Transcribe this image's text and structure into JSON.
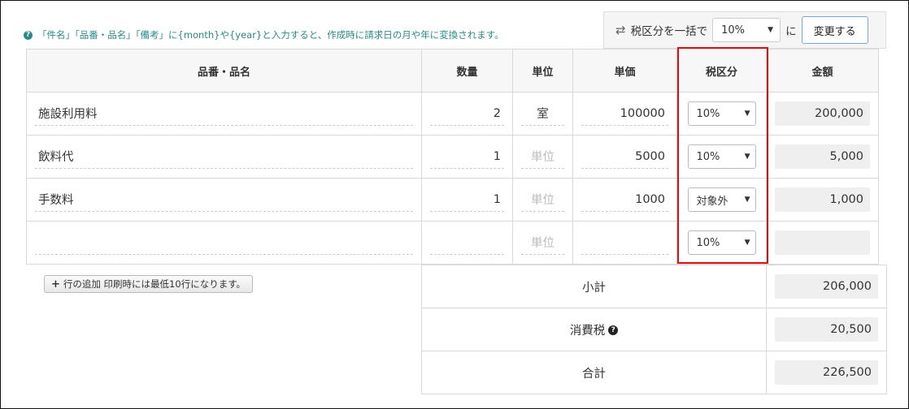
{
  "hint": {
    "text": "「件名」「品番・品名」「備考」に{month}や{year}と入力すると、作成時に請求日の月や年に変換されます。"
  },
  "bulk": {
    "label": "税区分を一括で",
    "selected": "10%",
    "suffix": "に",
    "button": "変更する"
  },
  "columns": {
    "name": "品番・品名",
    "qty": "数量",
    "unit": "単位",
    "price": "単価",
    "tax": "税区分",
    "amount": "金額"
  },
  "unit_placeholder": "単位",
  "rows": [
    {
      "name": "施設利用料",
      "qty": "2",
      "unit": "室",
      "price": "100000",
      "tax": "10%",
      "amount": "200,000"
    },
    {
      "name": "飲料代",
      "qty": "1",
      "unit": "",
      "price": "5000",
      "tax": "10%",
      "amount": "5,000"
    },
    {
      "name": "手数料",
      "qty": "1",
      "unit": "",
      "price": "1000",
      "tax": "対象外",
      "amount": "1,000"
    },
    {
      "name": "",
      "qty": "",
      "unit": "",
      "price": "",
      "tax": "10%",
      "amount": ""
    }
  ],
  "add_row": {
    "plus": "+",
    "label": "行の追加 印刷時には最低10行になります。"
  },
  "totals": {
    "subtotal_label": "小計",
    "subtotal": "206,000",
    "tax_label": "消費税",
    "tax": "20,500",
    "total_label": "合計",
    "total": "226,500"
  },
  "icons": {
    "help": "question-circle-icon",
    "swap": "swap-arrows-icon",
    "dropdown": "caret-down-icon"
  },
  "colors": {
    "hint": "#2a8a8a",
    "highlight": "#e01010",
    "button_border": "#7aa7e0"
  }
}
